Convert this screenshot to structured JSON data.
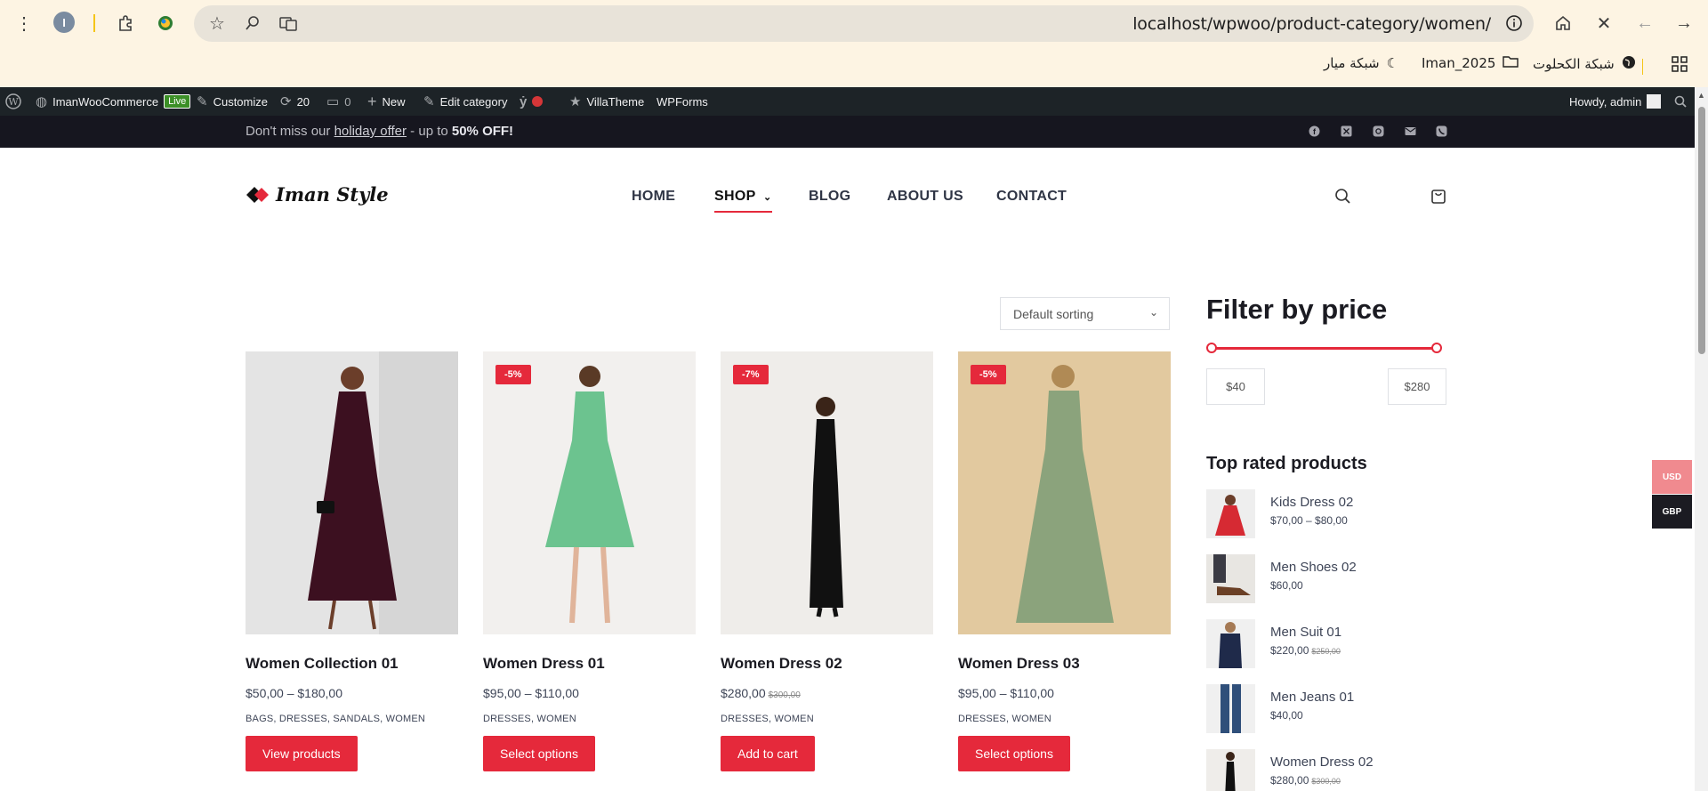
{
  "browser": {
    "profile_initial": "I",
    "url": "localhost/wpwoo/product-category/women/",
    "bookmarks": [
      {
        "label": "شبكة الكحلوت",
        "icon": "globe-icon"
      },
      {
        "label": "Iman_2025",
        "icon": "folder-icon"
      },
      {
        "label": "شبكة ميار",
        "icon": "moon-icon"
      }
    ]
  },
  "adminbar": {
    "site_name": "ImanWooCommerce",
    "live_badge": "Live",
    "customize": "Customize",
    "updates_count": "20",
    "comments_count": "0",
    "new": "New",
    "edit_category": "Edit category",
    "villatheme": "VillaTheme",
    "wpforms": "WPForms",
    "howdy": "Howdy, admin"
  },
  "topbar": {
    "promo_prefix": "Don't miss our ",
    "promo_link": "holiday offer",
    "promo_mid": " - up to ",
    "promo_bold": "50% OFF!"
  },
  "header": {
    "logo_text": "Iman Style",
    "nav": [
      "HOME",
      "SHOP",
      "BLOG",
      "ABOUT US",
      "CONTACT"
    ]
  },
  "sorting": {
    "selected": "Default sorting"
  },
  "products": [
    {
      "title": "Women Collection 01",
      "price": "$50,00 – $180,00",
      "old_price": "",
      "cats": "BAGS, DRESSES, SANDALS, WOMEN",
      "button": "View products",
      "badge": "",
      "dress_color": "#3c1020",
      "bg": "#e4e4e4"
    },
    {
      "title": "Women Dress 01",
      "price": "$95,00 – $110,00",
      "old_price": "",
      "cats": "DRESSES, WOMEN",
      "button": "Select options",
      "badge": "-5%",
      "dress_color": "#6cc38f",
      "bg": "#f2f0ee"
    },
    {
      "title": "Women Dress 02",
      "price": "$280,00",
      "old_price": "$300,00",
      "cats": "DRESSES, WOMEN",
      "button": "Add to cart",
      "badge": "-7%",
      "dress_color": "#111111",
      "bg": "#efedea"
    },
    {
      "title": "Women Dress 03",
      "price": "$95,00 – $110,00",
      "old_price": "",
      "cats": "DRESSES, WOMEN",
      "button": "Select options",
      "badge": "-5%",
      "dress_color": "#8ba37c",
      "bg": "#e2c99f"
    }
  ],
  "sidebar": {
    "filter_title": "Filter by price",
    "min_price": "$40",
    "max_price": "$280",
    "top_rated_title": "Top rated products",
    "top_rated": [
      {
        "name": "Kids Dress 02",
        "price": "$70,00 – $80,00",
        "old_price": "",
        "color": "#d62a33"
      },
      {
        "name": "Men Shoes 02",
        "price": "$60,00",
        "old_price": "",
        "color": "#6b4026"
      },
      {
        "name": "Men Suit 01",
        "price": "$220,00",
        "old_price": "$250,00",
        "color": "#1f2a4a"
      },
      {
        "name": "Men Jeans 01",
        "price": "$40,00",
        "old_price": "",
        "color": "#2f4f7a"
      },
      {
        "name": "Women Dress 02",
        "price": "$280,00",
        "old_price": "$300,00",
        "color": "#111111"
      }
    ]
  },
  "currency": {
    "usd": "USD",
    "gbp": "GBP"
  },
  "colors": {
    "accent": "#e5293b",
    "adminbar": "#1d2327",
    "topbar": "#16161f"
  }
}
